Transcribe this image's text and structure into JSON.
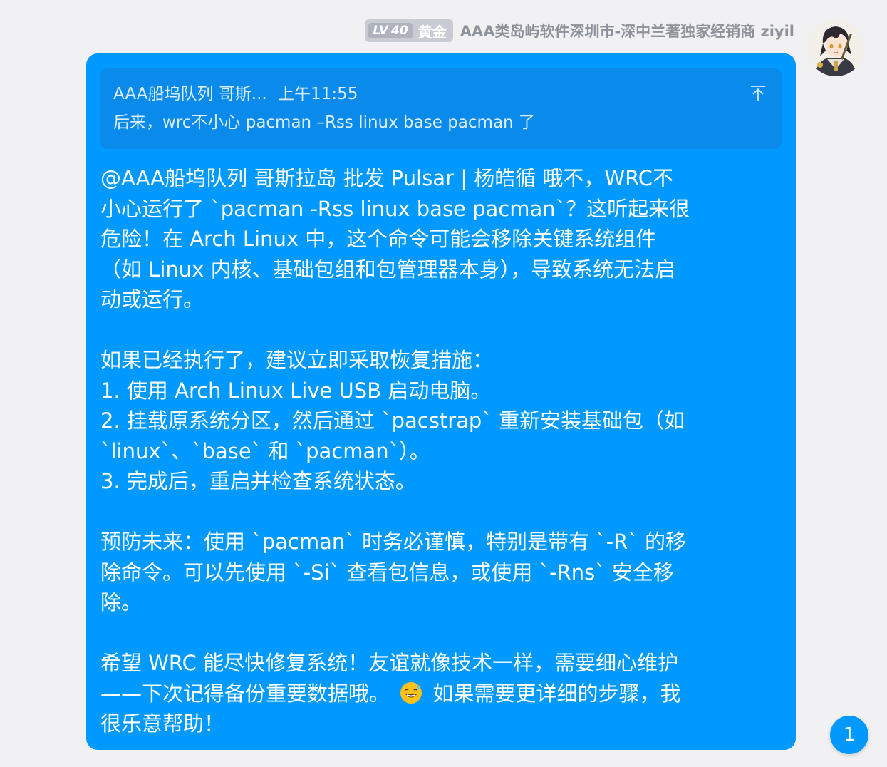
{
  "header": {
    "level_prefix": "LV",
    "level_number": "40",
    "rank": "黄金",
    "sender_name": "AAA类岛屿软件深圳市-深中兰著独家经销商 ziyil"
  },
  "avatar": {
    "icon": "anime-avatar-icon"
  },
  "quote": {
    "author": "AAA船坞队列 哥斯...",
    "time": "上午11:55",
    "text": "后来，wrc不小心 pacman –Rss linux base pacman 了",
    "icon": "arrow-up-to-top-icon"
  },
  "message": {
    "paragraphs": [
      {
        "lines": [
          "@AAA船坞队列 哥斯拉岛 批发 Pulsar | 杨皓循 哦不，WRC不",
          "小心运行了 `pacman -Rss linux base pacman`？这听起来很",
          "危险！在 Arch Linux 中，这个命令可能会移除关键系统组件",
          "（如 Linux 内核、基础包组和包管理器本身），导致系统无法启",
          "动或运行。"
        ]
      },
      {
        "lines": [
          "如果已经执行了，建议立即采取恢复措施：",
          "1. 使用 Arch Linux Live USB 启动电脑。",
          "2. 挂载原系统分区，然后通过 `pacstrap` 重新安装基础包（如",
          "`linux`、`base` 和 `pacman`）。",
          "3. 完成后，重启并检查系统状态。"
        ]
      },
      {
        "lines": [
          "预防未来：使用 `pacman` 时务必谨慎，特别是带有 `-R` 的移",
          "除命令。可以先使用 `-Si` 查看包信息，或使用 `-Rns` 安全移",
          "除。"
        ]
      },
      {
        "lines": [
          "希望 WRC 能尽快修复系统！友谊就像技术一样，需要细心维护"
        ],
        "emoji_line": {
          "before": "——下次记得备份重要数据哦。",
          "emoji": "sweat-smile-emoji",
          "after": "如果需要更详细的步骤，我"
        },
        "tail_lines": [
          "很乐意帮助！"
        ]
      }
    ]
  },
  "unread": {
    "count": "1"
  },
  "colors": {
    "bubble": "#0099ff",
    "quote_bg": "#0a8aeb",
    "page_bg": "#f1f1f3",
    "name_text": "#8e929a",
    "badge_bg": "#c9ccd3"
  }
}
